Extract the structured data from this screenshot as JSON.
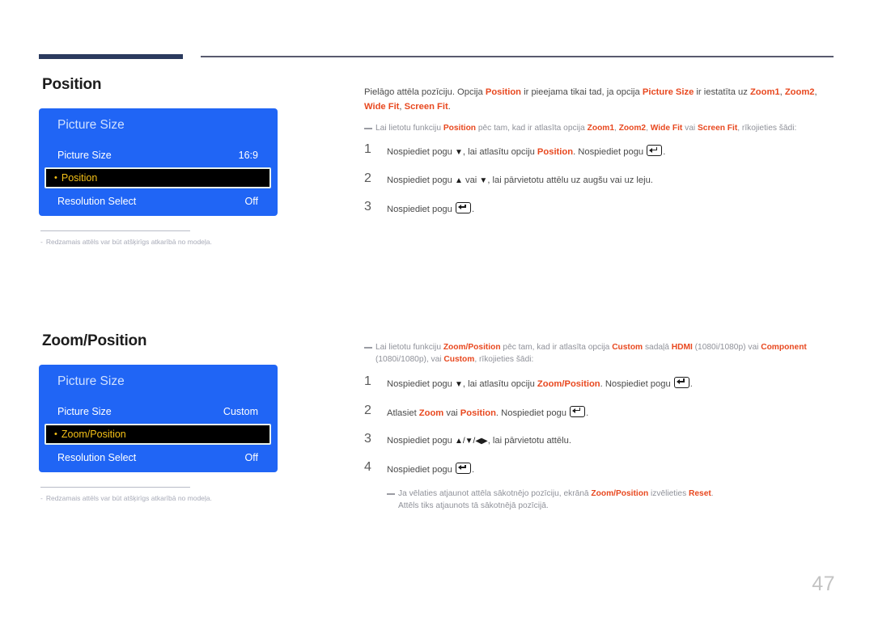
{
  "page": {
    "number": "47"
  },
  "sections": [
    {
      "heading": "Position",
      "osd": {
        "title": "Picture Size",
        "rows": [
          {
            "label": "Picture Size",
            "value": "16:9",
            "selected": false
          },
          {
            "label": "Position",
            "value": "",
            "selected": true
          },
          {
            "label": "Resolution Select",
            "value": "Off",
            "selected": false
          }
        ]
      },
      "footnote": {
        "dash": "-",
        "text": "Redzamais attēls var būt atšķirīgs atkarībā no modeļa."
      },
      "intro": {
        "p1": "Pielāgo attēla pozīciju. Opcija ",
        "e1": "Position",
        "p2": " ir pieejama tikai tad, ja opcija ",
        "e2": "Picture Size",
        "p3": " ir iestatīta uz ",
        "e3": "Zoom1",
        "p4": ", ",
        "e4": "Zoom2",
        "p5": ", ",
        "e5": "Wide Fit",
        "p6": ", ",
        "e6": "Screen Fit",
        "p7": "."
      },
      "note": {
        "p1": "Lai lietotu funkciju ",
        "e1": "Position",
        "p2": " pēc tam, kad ir atlasīta opcija ",
        "e2": "Zoom1",
        "p3": ", ",
        "e3": "Zoom2",
        "p4": ", ",
        "e4": "Wide Fit",
        "p5": " vai ",
        "e5": "Screen Fit",
        "p6": ", rīkojieties šādi:"
      },
      "steps": [
        {
          "num": "1",
          "p1": "Nospiediet pogu ",
          "glyph1": "▼",
          "p2": ", lai atlasītu opciju ",
          "e1": "Position",
          "p3": ". Nospiediet pogu ",
          "key": "enter-key-icon",
          "p4": "."
        },
        {
          "num": "2",
          "p1": "Nospiediet pogu ",
          "glyph1": "▲",
          "p2": " vai ",
          "glyph2": "▼",
          "p3": ", lai pārvietotu attēlu uz augšu vai uz leju.",
          "e1": "",
          "p4": "",
          "key": "",
          "p5": ""
        },
        {
          "num": "3",
          "p1": "Nospiediet pogu ",
          "key": "enter-key-icon",
          "p2": "."
        }
      ]
    },
    {
      "heading": "Zoom/Position",
      "osd": {
        "title": "Picture Size",
        "rows": [
          {
            "label": "Picture Size",
            "value": "Custom",
            "selected": false
          },
          {
            "label": "Zoom/Position",
            "value": "",
            "selected": true
          },
          {
            "label": "Resolution Select",
            "value": "Off",
            "selected": false
          }
        ]
      },
      "footnote": {
        "dash": "-",
        "text": "Redzamais attēls var būt atšķirīgs atkarībā no modeļa."
      },
      "note": {
        "p1": "Lai lietotu funkciju ",
        "e1": "Zoom/Position",
        "p2": " pēc tam, kad ir atlasīta opcija ",
        "e2": "Custom",
        "p3": " sadaļā ",
        "e3": "HDMI",
        "p4": " (1080i/1080p) vai ",
        "e4": "Component",
        "p5": " (1080i/1080p), vai ",
        "e5": "Custom",
        "p6": ", rīkojieties šādi:"
      },
      "steps": [
        {
          "num": "1",
          "p1": "Nospiediet pogu ",
          "glyph1": "▼",
          "p2": ", lai atlasītu opciju ",
          "e1": "Zoom/Position",
          "p3": ". Nospiediet pogu ",
          "key": "enter-key-icon",
          "p4": "."
        },
        {
          "num": "2",
          "p1": "Atlasiet ",
          "e1": "Zoom",
          "p2": " vai ",
          "e2": "Position",
          "p3": ". Nospiediet pogu ",
          "key": "enter-key-icon",
          "p4": "."
        },
        {
          "num": "3",
          "p1": "Nospiediet pogu ",
          "glyph1": "▲/▼/◀▶",
          "p2": ", lai pārvietotu attēlu."
        },
        {
          "num": "4",
          "p1": "Nospiediet pogu ",
          "key": "enter-key-icon",
          "p2": "."
        }
      ],
      "subnote": {
        "p1": "Ja vēlaties atjaunot attēla sākotnējo pozīciju, ekrānā ",
        "e1": "Zoom/Position",
        "p2": " izvēlieties ",
        "e2": "Reset",
        "p3": ".",
        "line2": "Attēls tiks atjaunots tā sākotnējā pozīcijā."
      }
    }
  ],
  "colors": {
    "osd_blue": "#2065f5",
    "accent_orange": "#e8481f",
    "highlight_yellow": "#f4c017",
    "rule_navy": "#2b3a5e"
  }
}
